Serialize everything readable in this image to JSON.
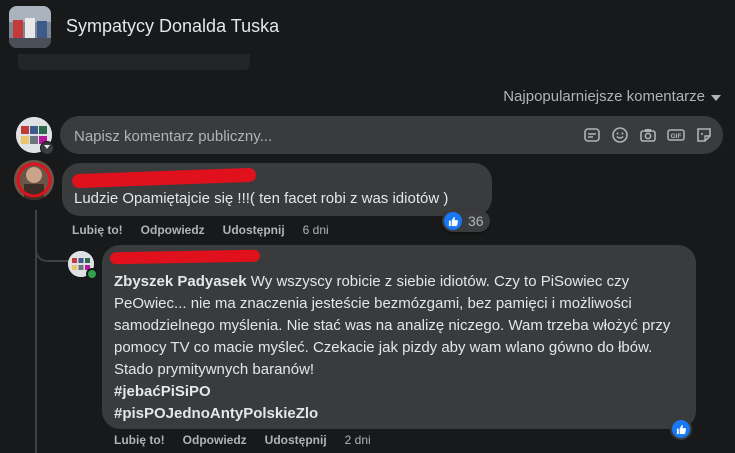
{
  "group": {
    "title": "Sympatycy Donalda Tuska"
  },
  "sort": {
    "label": "Najpopularniejsze komentarze"
  },
  "composer": {
    "placeholder": "Napisz komentarz publiczny...",
    "icons": [
      "sticker-icon",
      "emoji-icon",
      "camera-icon",
      "gif-icon",
      "gif-sticker-icon"
    ]
  },
  "comments": [
    {
      "author": "",
      "text": "Ludzie Opamiętajcie się !!!( ten facet robi z was idiotów )",
      "reactions": {
        "count": "36",
        "icon": "like-icon"
      },
      "actions": {
        "like": "Lubię to!",
        "reply": "Odpowiedz",
        "share": "Udostępnij",
        "time": "6 dni"
      },
      "replies": [
        {
          "author": "",
          "mention": "Zbyszek Padyasek",
          "text": " Wy wszyscy robicie z siebie idiotów. Czy to PiSowiec czy PeOwiec... nie ma znaczenia jesteście bezmózgami, bez pamięci i możliwości samodzielnego myślenia. Nie stać was na analizę niczego. Wam trzeba włożyć przy pomocy TV co macie myśleć. Czekacie jak pizdy aby wam wlano gówno do łbów. Stado prymitywnych baranów!",
          "hashtags": [
            "#jebaćPiSiPO",
            "#pisPOJednoAntyPolskieZlo"
          ],
          "reactions": {
            "icon": "like-icon"
          },
          "actions": {
            "like": "Lubię to!",
            "reply": "Odpowiedz",
            "share": "Udostępnij",
            "time": "2 dni"
          }
        }
      ]
    }
  ],
  "colors": {
    "background": "#18191a",
    "bubble": "#3a3b3c",
    "like": "#1877f2",
    "redaction": "#e0111d"
  }
}
